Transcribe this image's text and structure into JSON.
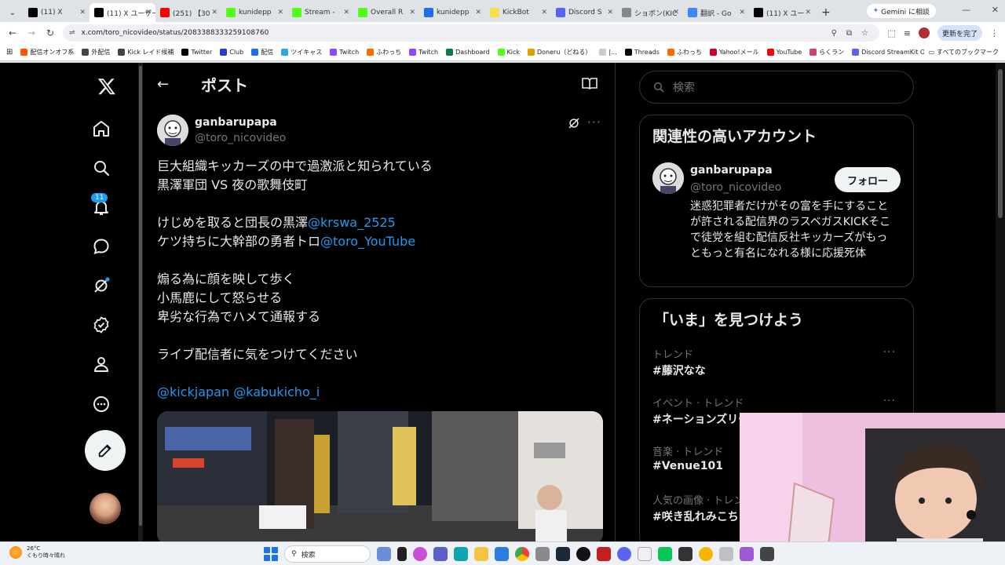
{
  "browser": {
    "tabs": [
      {
        "label": "(11) X",
        "color": "#000000"
      },
      {
        "label": "(11) X ユーザー",
        "color": "#000000",
        "active": true
      },
      {
        "label": "(251) 【30",
        "color": "#ff0000"
      },
      {
        "label": "kunidepp",
        "color": "#53fc18"
      },
      {
        "label": "Stream -",
        "color": "#53fc18"
      },
      {
        "label": "Overall R",
        "color": "#53fc18"
      },
      {
        "label": "kunidepp",
        "color": "#1f6feb"
      },
      {
        "label": "KickBot",
        "color": "#f3e04a"
      },
      {
        "label": "Discord S",
        "color": "#5865f2"
      },
      {
        "label": "ショボン(KIC",
        "color": "#888888"
      },
      {
        "label": "翻訳 - Go",
        "color": "#4285f4"
      },
      {
        "label": "(11) X ユー",
        "color": "#000000"
      }
    ],
    "gemini_label": "Gemini に相談",
    "url": "x.com/toro_nicovideo/status/2083388333259108760",
    "update_label": "更新を完了",
    "bookmarks": [
      {
        "label": "配信オンオフ系",
        "color": "#ff5500"
      },
      {
        "label": "外配信",
        "color": "#444444"
      },
      {
        "label": "Kick レイド候補",
        "color": "#444444"
      },
      {
        "label": "Twitter",
        "color": "#000000"
      },
      {
        "label": "Club",
        "color": "#2b3cc8"
      },
      {
        "label": "配信",
        "color": "#1f6feb"
      },
      {
        "label": "ツイキャス",
        "color": "#2aa8e0"
      },
      {
        "label": "Twitch",
        "color": "#9146ff"
      },
      {
        "label": "ふわっち",
        "color": "#ff6a00"
      },
      {
        "label": "Twitch",
        "color": "#9146ff"
      },
      {
        "label": "Dashboard",
        "color": "#0e7a4a"
      },
      {
        "label": "Kick",
        "color": "#53fc18"
      },
      {
        "label": "Doneru（どねる）",
        "color": "#e0a000"
      },
      {
        "label": "|...",
        "color": "#cccccc"
      },
      {
        "label": "Threads",
        "color": "#000000"
      },
      {
        "label": "ふわっち",
        "color": "#ff6a00"
      },
      {
        "label": "Yahoo!メール",
        "color": "#cc0033"
      },
      {
        "label": "YouTube",
        "color": "#ff0000"
      },
      {
        "label": "らくラン",
        "color": "#cc4477"
      },
      {
        "label": "Discord StreamKit O...",
        "color": "#5865f2"
      }
    ],
    "bookmarks_right": "すべてのブックマーク"
  },
  "leftnav": {
    "notification_count": "11"
  },
  "post": {
    "header_title": "ポスト",
    "author_name": "ganbarupapa",
    "author_handle": "@toro_nicovideo",
    "line1": "巨大組織キッカーズの中で過激派と知られている",
    "line2": "黒澤軍団 VS 夜の歌舞伎町",
    "line3_text": "けじめを取ると団長の黒澤",
    "line3_mention": "@krswa_2525",
    "line4_text": "ケツ持ちに大幹部の勇者トロ",
    "line4_mention": "@toro_YouTube",
    "line5": "煽る為に顔を映して歩く",
    "line6": "小馬鹿にして怒らせる",
    "line7": "卑劣な行為でハメて通報する",
    "line8": "ライブ配信者に気をつけてください",
    "line9_mentions": "@kickjapan @kabukicho_i"
  },
  "sidebar": {
    "search_placeholder": "検索",
    "related_title": "関連性の高いアカウント",
    "related_name": "ganbarupapa",
    "related_handle": "@toro_nicovideo",
    "follow_label": "フォロー",
    "related_bio": "迷惑犯罪者だけがその富を手にすることが許される配信界のラスベガスKICKそこで徒党を組む配信反社キッカーズがもっともっと有名になれる様に応援死体",
    "trends_title": "「いま」を見つけよう",
    "trends": [
      {
        "category": "トレンド",
        "name": "#藤沢なな"
      },
      {
        "category": "イベント · トレンド",
        "name": "#ネーションズリーグ"
      },
      {
        "category": "音楽 · トレンド",
        "name": "#Venue101"
      },
      {
        "category": "人気の画像 · トレンド",
        "name": "#咲き乱れみこち"
      }
    ]
  },
  "taskbar": {
    "temp": "26°C",
    "weather": "くもり時々晴れ",
    "search_label": "検索"
  }
}
